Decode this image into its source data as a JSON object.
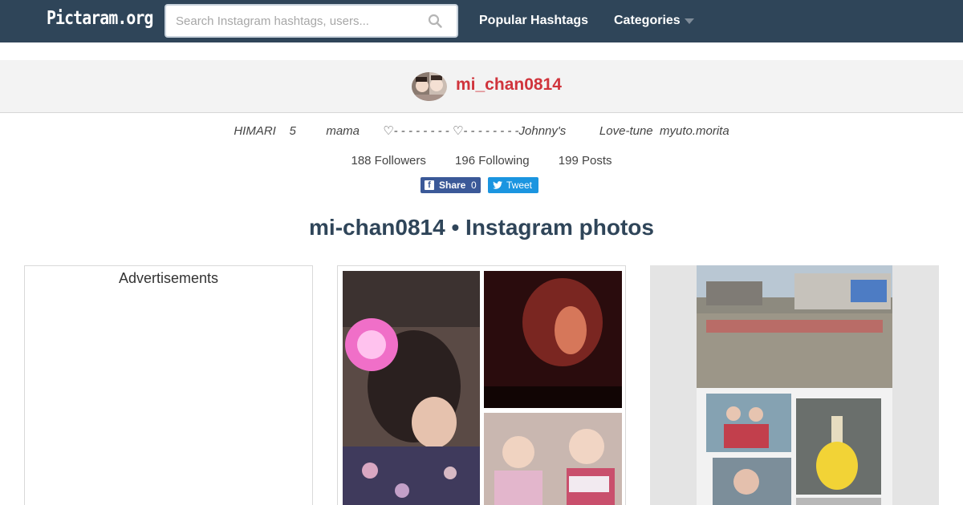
{
  "navbar": {
    "logo": "Pictaram.org",
    "search_placeholder": "Search Instagram hashtags, users...",
    "popular_hashtags": "Popular Hashtags",
    "categories": "Categories"
  },
  "profile": {
    "username": "mi_chan0814",
    "bio": "HIMARI    5         mama       ♡- - - - - - - - ♡- - - - - - - -Johnny's          Love-tune  myuto.morita",
    "followers": "188 Followers",
    "following": "196 Following",
    "posts": "199 Posts"
  },
  "social": {
    "share_label": "Share",
    "share_count": "0",
    "tweet_label": "Tweet"
  },
  "page_title": "mi-chan0814 • Instagram photos",
  "ad": {
    "title": "Advertisements"
  },
  "colors": {
    "navbar": "#2f4559",
    "username": "#d0343c",
    "facebook": "#3b5998",
    "twitter": "#1b95e0"
  }
}
